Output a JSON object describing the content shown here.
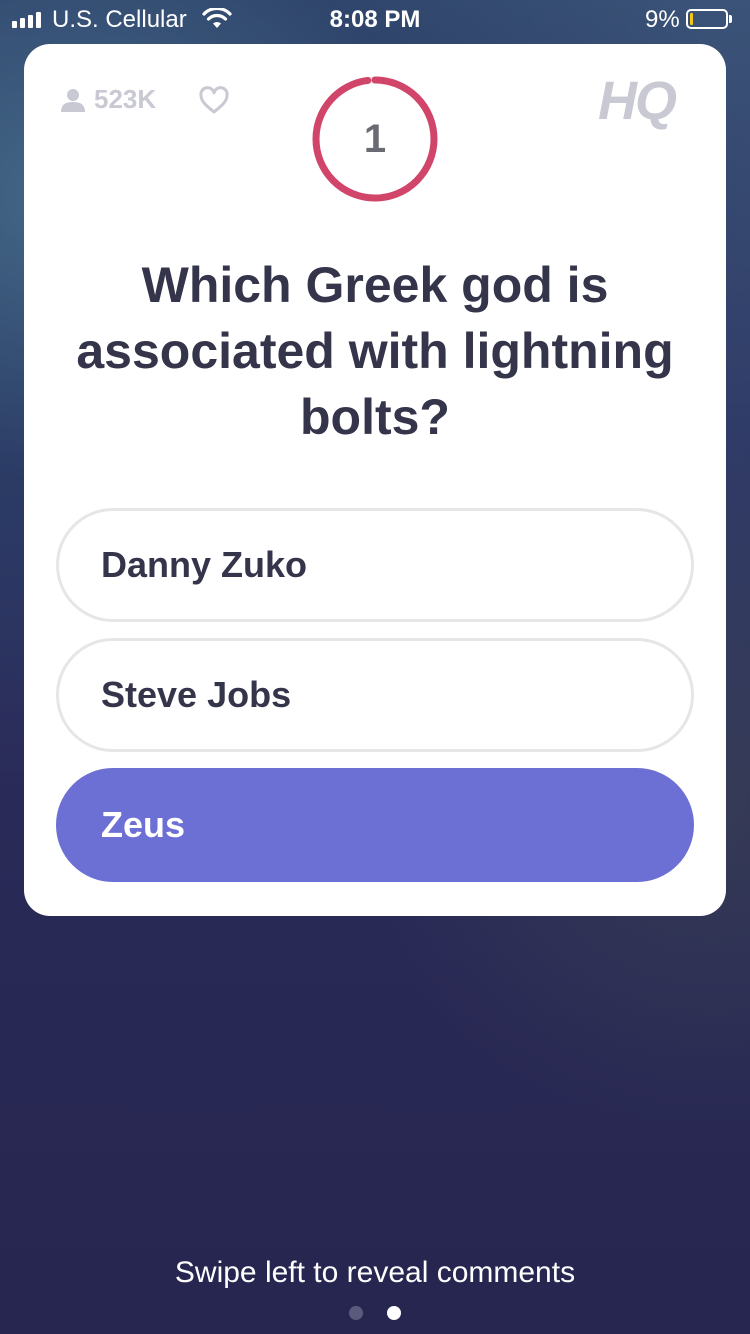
{
  "status_bar": {
    "carrier": "U.S. Cellular",
    "time": "8:08 PM",
    "battery_percent_label": "9%",
    "battery_level": 0.09,
    "signal_bars": 4,
    "battery_color": "#f5c518"
  },
  "header": {
    "viewer_count": "523K",
    "viewer_icon": "person-icon",
    "like_icon": "heart-icon",
    "logo": "HQ"
  },
  "timer": {
    "value": "1",
    "remaining_fraction": 0.98,
    "ring_color": "#d2456b"
  },
  "question": {
    "text": "Which Greek god is associated with lightning bolts?"
  },
  "answers": [
    {
      "label": "Danny Zuko",
      "selected": false
    },
    {
      "label": "Steve Jobs",
      "selected": false
    },
    {
      "label": "Zeus",
      "selected": true
    }
  ],
  "colors": {
    "selected_answer": "#6c6fd3",
    "question_text": "#34344a"
  },
  "footer": {
    "hint": "Swipe left to reveal comments",
    "page_count": 2,
    "active_page": 2
  }
}
